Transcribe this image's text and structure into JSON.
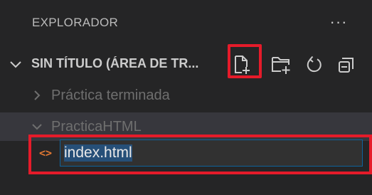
{
  "explorer": {
    "header": "EXPLORADOR",
    "more_actions": "···"
  },
  "workspace": {
    "title": "SIN TÍTULO (ÁREA DE TR...",
    "toolbar": {
      "new_file_icon": "new-file-icon",
      "new_folder_icon": "new-folder-icon",
      "refresh_icon": "refresh-icon",
      "collapse_icon": "collapse-all-icon"
    }
  },
  "tree": {
    "folders": [
      {
        "label": "Práctica terminada",
        "expanded": false
      },
      {
        "label": "PracticaHTML",
        "expanded": true
      }
    ],
    "editing_file": {
      "icon": "<>",
      "value": "index.html"
    }
  },
  "colors": {
    "highlight": "#e51b2a",
    "html_icon": "#e37933",
    "input_border": "#0e639c"
  }
}
